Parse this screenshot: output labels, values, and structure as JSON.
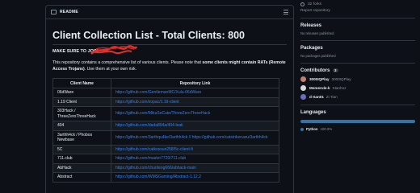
{
  "readme": {
    "header_label": "README",
    "title": "Client Collection List - Total Clients: 800",
    "make_sure_text": "MAKE SURE TO JOIN",
    "description_pre": "This repository contains a comprehensive list of various clients. Please note that ",
    "description_bold": "some clients might contain RATs (Remote Access Trojans)",
    "description_post": ". Use them at your own risk.",
    "table": {
      "headers": [
        "Client Name",
        "Repository Link"
      ],
      "rows": [
        {
          "name": "06dWare",
          "link": "https://github.com/GentlemanMC/Xulu-06dWare"
        },
        {
          "name": "1.19 Client",
          "link": "https://github.com/zopac/1.19-client"
        },
        {
          "name": "303Hack / ThreeZeroThreeHack",
          "link": "https://github.com/MikuSoCute/ThreeZeroThreeHack"
        },
        {
          "name": "404",
          "link": "https://github.com/dada894a/404-leak"
        },
        {
          "name": "3arthh4ck / Phobos Newbase",
          "link": "https://github.com/3arthqu4ke/3arthh4ck // https://github.com/catstrikeruwu/3arthh4ck"
        },
        {
          "name": "5C",
          "link": "https://github.com/catkossun258/5c-client-fi"
        },
        {
          "name": "711.club",
          "link": "https://github.com/master7720/711.club"
        },
        {
          "name": "AbHack",
          "link": "https://github.com/chunfeng666/abhack-main"
        },
        {
          "name": "Abstract",
          "link": "https://github.com/WMSGaming/Abstract-1.12.2"
        }
      ]
    }
  },
  "sidebar": {
    "forks_text": "32 forks",
    "report_text": "Report repository",
    "releases": {
      "title": "Releases",
      "subtitle": "No releases published"
    },
    "packages": {
      "title": "Packages",
      "subtitle": "No packages published"
    },
    "contributors": {
      "title": "Contributors",
      "count": "3",
      "people": [
        {
          "login": "3000IQPlay",
          "handle": "3000IQPlay",
          "color": "#c08070"
        },
        {
          "login": "Memerule-k",
          "handle": "Stanhoz",
          "color": "#d8d8d8"
        },
        {
          "login": "d-Xan01",
          "handle": "Zi Tian",
          "color": "#6d6dc0"
        }
      ]
    },
    "languages": {
      "title": "Languages",
      "items": [
        {
          "name": "Python",
          "percent": "100.0%",
          "color": "#3572A5"
        }
      ]
    }
  }
}
